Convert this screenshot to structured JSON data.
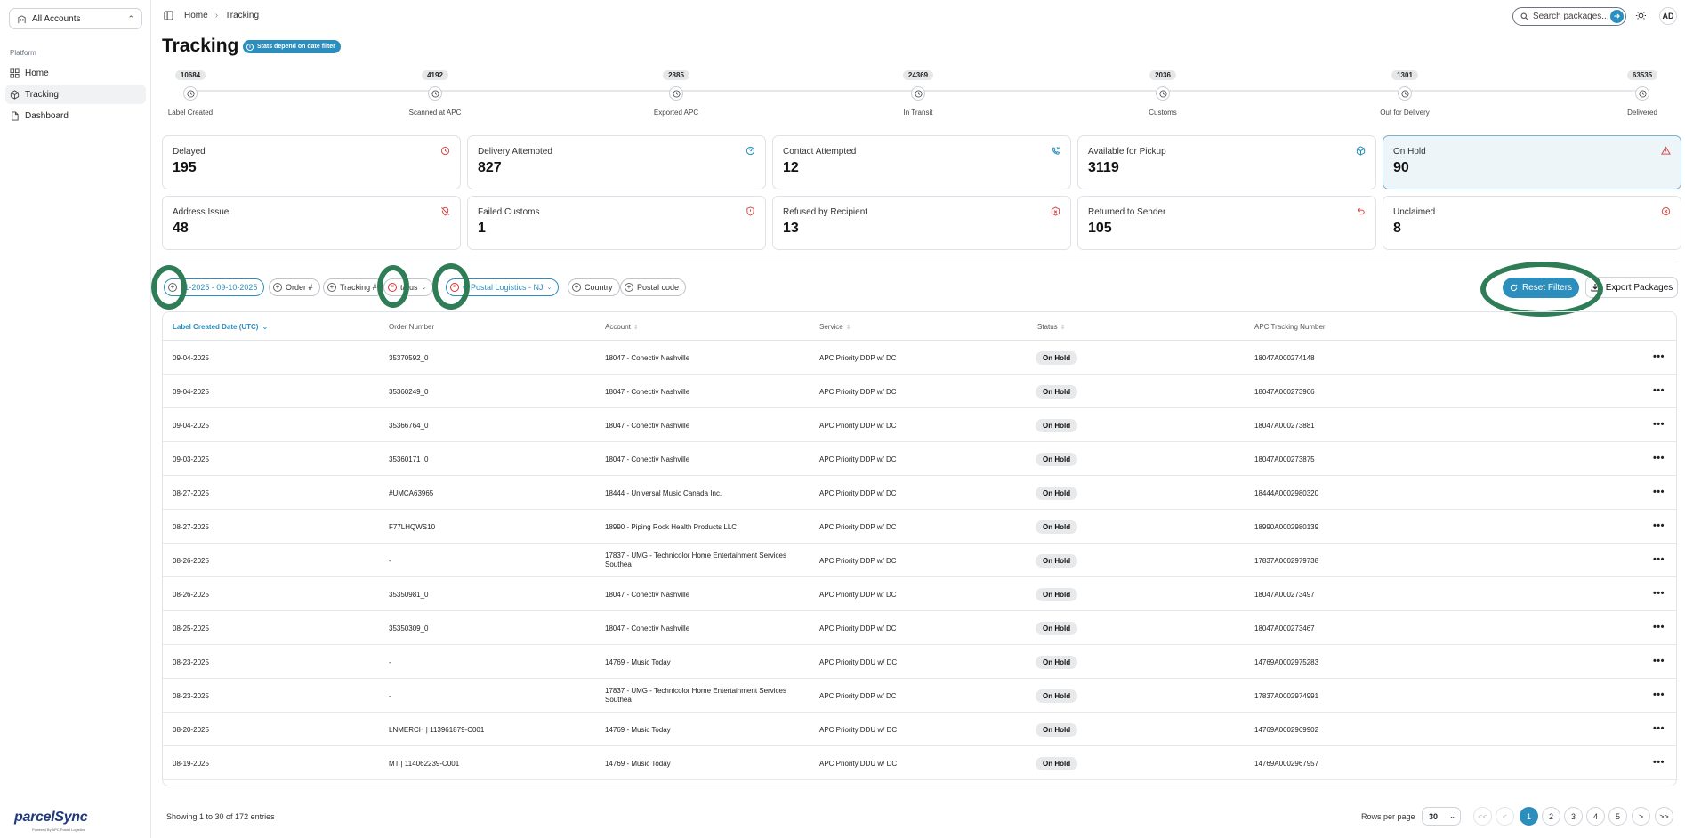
{
  "sidebar": {
    "account_select": "All Accounts",
    "section_label": "Platform",
    "items": [
      {
        "label": "Home",
        "icon": "grid-icon",
        "active": false
      },
      {
        "label": "Tracking",
        "icon": "package-icon",
        "active": true
      },
      {
        "label": "Dashboard",
        "icon": "document-icon",
        "active": false
      }
    ],
    "logo_text": "parcelSync",
    "logo_tagline": "Powered By APC Postal Logistics"
  },
  "topbar": {
    "breadcrumb": [
      "Home",
      "Tracking"
    ],
    "search_placeholder": "Search packages...",
    "avatar_initials": "AD"
  },
  "page": {
    "title": "Tracking",
    "info_badge": "Stats depend on date filter"
  },
  "timeline": [
    {
      "count": "10684",
      "label": "Label Created"
    },
    {
      "count": "4192",
      "label": "Scanned at APC"
    },
    {
      "count": "2885",
      "label": "Exported APC"
    },
    {
      "count": "24369",
      "label": "In Transit"
    },
    {
      "count": "2036",
      "label": "Customs"
    },
    {
      "count": "1301",
      "label": "Out for Delivery"
    },
    {
      "count": "63535",
      "label": "Delivered"
    }
  ],
  "stat_cards": [
    {
      "label": "Delayed",
      "value": "195",
      "icon": "clock-alert-icon",
      "icon_color": "#d94c4c"
    },
    {
      "label": "Delivery Attempted",
      "value": "827",
      "icon": "question-icon",
      "icon_color": "#2b8ebd"
    },
    {
      "label": "Contact Attempted",
      "value": "12",
      "icon": "phone-icon",
      "icon_color": "#2b8ebd"
    },
    {
      "label": "Available for Pickup",
      "value": "3119",
      "icon": "box-icon",
      "icon_color": "#2b8ebd"
    },
    {
      "label": "On Hold",
      "value": "90",
      "icon": "warning-icon",
      "icon_color": "#d94c4c",
      "selected": true
    },
    {
      "label": "Address Issue",
      "value": "48",
      "icon": "map-pin-off-icon",
      "icon_color": "#d94c4c"
    },
    {
      "label": "Failed Customs",
      "value": "1",
      "icon": "shield-alert-icon",
      "icon_color": "#d94c4c"
    },
    {
      "label": "Refused by Recipient",
      "value": "13",
      "icon": "package-x-icon",
      "icon_color": "#d94c4c"
    },
    {
      "label": "Returned to Sender",
      "value": "105",
      "icon": "undo-icon",
      "icon_color": "#d94c4c"
    },
    {
      "label": "Unclaimed",
      "value": "8",
      "icon": "x-circle-icon",
      "icon_color": "#d94c4c"
    }
  ],
  "filters": {
    "date_range": "11-2025 - 09-10-2025",
    "order": "Order #",
    "tracking": "Tracking #",
    "status": "tatus",
    "account": "C Postal Logistics - NJ",
    "country": "Country",
    "postal_code": "Postal code",
    "reset_label": "Reset Filters",
    "export_label": "Export Packages"
  },
  "table": {
    "headers": [
      "Label Created Date (UTC)",
      "Order Number",
      "Account",
      "Service",
      "Status",
      "APC Tracking Number"
    ],
    "rows": [
      [
        "09-04-2025",
        "35370592_0",
        "18047 - Conectiv Nashville",
        "APC Priority DDP w/ DC",
        "On Hold",
        "18047A000274148"
      ],
      [
        "09-04-2025",
        "35360249_0",
        "18047 - Conectiv Nashville",
        "APC Priority DDP w/ DC",
        "On Hold",
        "18047A000273906"
      ],
      [
        "09-04-2025",
        "35366764_0",
        "18047 - Conectiv Nashville",
        "APC Priority DDP w/ DC",
        "On Hold",
        "18047A000273881"
      ],
      [
        "09-03-2025",
        "35360171_0",
        "18047 - Conectiv Nashville",
        "APC Priority DDP w/ DC",
        "On Hold",
        "18047A000273875"
      ],
      [
        "08-27-2025",
        "#UMCA63965",
        "18444 - Universal Music Canada Inc.",
        "APC Priority DDP w/ DC",
        "On Hold",
        "18444A0002980320"
      ],
      [
        "08-27-2025",
        "F77LHQWS10",
        "18990 - Piping Rock Health Products LLC",
        "APC Priority DDP w/ DC",
        "On Hold",
        "18990A0002980139"
      ],
      [
        "08-26-2025",
        "-",
        "17837 - UMG - Technicolor Home Entertainment Services Southea",
        "APC Priority DDP w/ DC",
        "On Hold",
        "17837A0002979738"
      ],
      [
        "08-26-2025",
        "35350981_0",
        "18047 - Conectiv Nashville",
        "APC Priority DDP w/ DC",
        "On Hold",
        "18047A000273497"
      ],
      [
        "08-25-2025",
        "35350309_0",
        "18047 - Conectiv Nashville",
        "APC Priority DDP w/ DC",
        "On Hold",
        "18047A000273467"
      ],
      [
        "08-23-2025",
        "-",
        "14769 - Music Today",
        "APC Priority DDU w/ DC",
        "On Hold",
        "14769A0002975283"
      ],
      [
        "08-23-2025",
        "-",
        "17837 - UMG - Technicolor Home Entertainment Services Southea",
        "APC Priority DDP w/ DC",
        "On Hold",
        "17837A0002974991"
      ],
      [
        "08-20-2025",
        "LNMERCH | 113961879-C001",
        "14769 - Music Today",
        "APC Priority DDU w/ DC",
        "On Hold",
        "14769A0002969902"
      ],
      [
        "08-19-2025",
        "MT | 114062239-C001",
        "14769 - Music Today",
        "APC Priority DDU w/ DC",
        "On Hold",
        "14769A0002967957"
      ]
    ]
  },
  "footer": {
    "showing": "Showing 1 to 30 of 172 entries",
    "rows_per_page_label": "Rows per page",
    "rows_per_page": "30",
    "pages": [
      "<<",
      "<",
      "1",
      "2",
      "3",
      "4",
      "5",
      ">",
      ">>"
    ],
    "current_page": "1"
  },
  "colors": {
    "accent": "#2b8ebd",
    "danger": "#d94c4c",
    "annotation_ring": "#2f7d57"
  }
}
